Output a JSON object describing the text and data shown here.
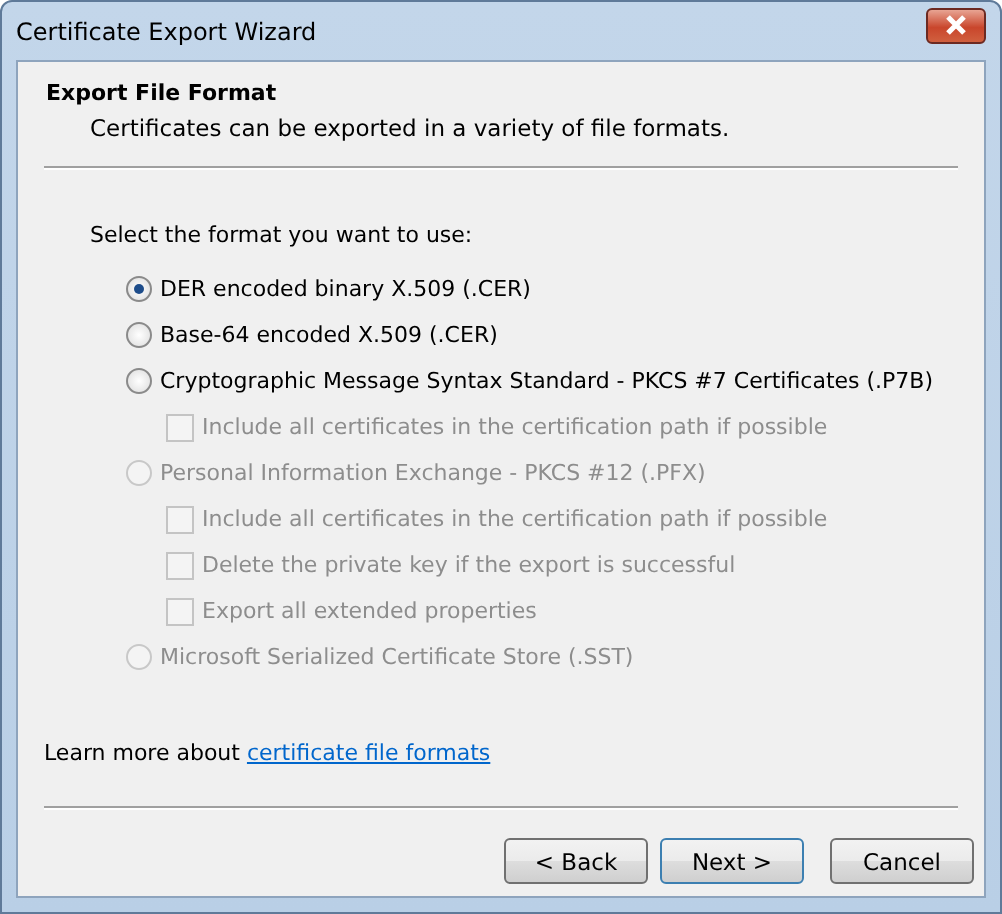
{
  "window": {
    "title": "Certificate Export Wizard"
  },
  "header": {
    "title": "Export File Format",
    "subtitle": "Certificates can be exported in a variety of file formats."
  },
  "prompt": "Select the format you want to use:",
  "formats": [
    {
      "label": "DER encoded binary X.509 (.CER)",
      "selected": true,
      "disabled": false
    },
    {
      "label": "Base-64 encoded X.509 (.CER)",
      "selected": false,
      "disabled": false
    },
    {
      "label": "Cryptographic Message Syntax Standard - PKCS #7 Certificates (.P7B)",
      "selected": false,
      "disabled": false,
      "options": [
        {
          "label": "Include all certificates in the certification path if possible",
          "checked": false,
          "disabled": true
        }
      ]
    },
    {
      "label": "Personal Information Exchange - PKCS #12 (.PFX)",
      "selected": false,
      "disabled": true,
      "options": [
        {
          "label": "Include all certificates in the certification path if possible",
          "checked": false,
          "disabled": true
        },
        {
          "label": "Delete the private key if the export is successful",
          "checked": false,
          "disabled": true
        },
        {
          "label": "Export all extended properties",
          "checked": false,
          "disabled": true
        }
      ]
    },
    {
      "label": "Microsoft Serialized Certificate Store (.SST)",
      "selected": false,
      "disabled": true
    }
  ],
  "learn_more": {
    "text": "Learn more about",
    "link": "certificate file formats"
  },
  "buttons": [
    {
      "label": "< Back",
      "kind": "normal"
    },
    {
      "label": "Next >",
      "kind": "default"
    },
    {
      "label": "Cancel",
      "kind": "gap"
    }
  ]
}
